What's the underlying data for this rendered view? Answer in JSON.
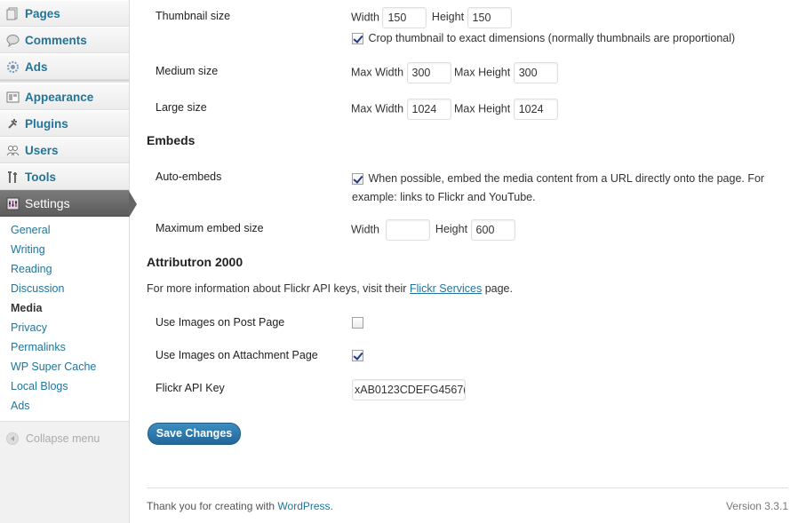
{
  "sidebar": {
    "group1": [
      {
        "label": "Pages",
        "icon": "pages-icon"
      },
      {
        "label": "Comments",
        "icon": "comments-icon"
      },
      {
        "label": "Ads",
        "icon": "ads-icon"
      }
    ],
    "group2": [
      {
        "label": "Appearance",
        "icon": "appearance-icon"
      },
      {
        "label": "Plugins",
        "icon": "plugins-icon"
      },
      {
        "label": "Users",
        "icon": "users-icon"
      },
      {
        "label": "Tools",
        "icon": "tools-icon"
      }
    ],
    "settings": {
      "label": "Settings",
      "icon": "settings-icon"
    },
    "submenu": [
      "General",
      "Writing",
      "Reading",
      "Discussion",
      "Media",
      "Privacy",
      "Permalinks",
      "WP Super Cache",
      "Local Blogs",
      "Ads"
    ],
    "current_submenu": "Media",
    "collapse_label": "Collapse menu"
  },
  "image_sizes": {
    "thumbnail": {
      "label": "Thumbnail size",
      "width_label": "Width",
      "width": "150",
      "height_label": "Height",
      "height": "150",
      "crop_checked": true,
      "crop_label": "Crop thumbnail to exact dimensions (normally thumbnails are proportional)"
    },
    "medium": {
      "label": "Medium size",
      "width_label": "Max Width",
      "width": "300",
      "height_label": "Max Height",
      "height": "300"
    },
    "large": {
      "label": "Large size",
      "width_label": "Max Width",
      "width": "1024",
      "height_label": "Max Height",
      "height": "1024"
    }
  },
  "embeds": {
    "heading": "Embeds",
    "auto_label": "Auto-embeds",
    "auto_checked": true,
    "auto_desc_line1": "When possible, embed the media content from a URL directly onto the page. For",
    "auto_desc_line2": "example: links to Flickr and YouTube.",
    "max_label": "Maximum embed size",
    "width_label": "Width",
    "width": "",
    "height_label": "Height",
    "height": "600"
  },
  "attributron": {
    "heading": "Attributron 2000",
    "info_prefix": "For more information about Flickr API keys, visit their",
    "info_link": "Flickr Services",
    "info_suffix": "page.",
    "post_label": "Use Images on Post Page",
    "post_checked": false,
    "attach_label": "Use Images on Attachment Page",
    "attach_checked": true,
    "api_label": "Flickr API Key",
    "api_value": "xAB0123CDEFG4567("
  },
  "save_label": "Save Changes",
  "footer": {
    "thanks_prefix": "Thank you for creating with",
    "thanks_link": "WordPress",
    "thanks_suffix": ".",
    "version": "Version 3.3.1"
  },
  "colors": {
    "link": "#21759b",
    "button": "#22669a",
    "current_menu": "#646464"
  }
}
